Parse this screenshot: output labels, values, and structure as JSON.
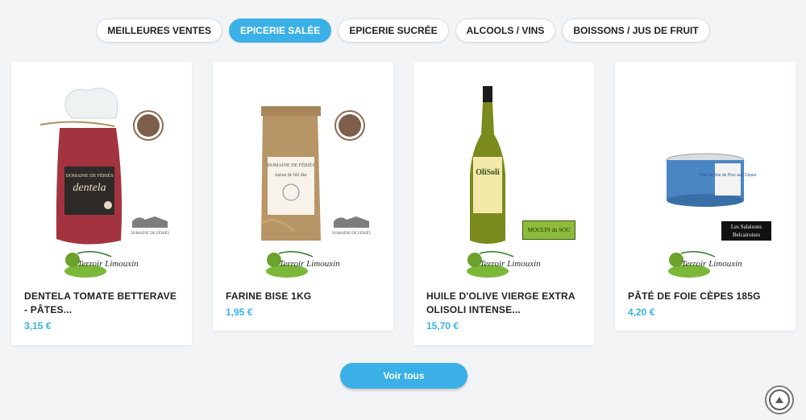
{
  "tabs": [
    {
      "label": "MEILLEURES VENTES",
      "active": false
    },
    {
      "label": "EPICERIE SALÉE",
      "active": true
    },
    {
      "label": "EPICERIE SUCRÉE",
      "active": false
    },
    {
      "label": "ALCOOLS / VINS",
      "active": false
    },
    {
      "label": "BOISSONS / JUS DE FRUIT",
      "active": false
    }
  ],
  "products": [
    {
      "name": "DENTELA TOMATE BETTERAVE - PÂTES...",
      "price": "3,15 €",
      "image": "pasta-bag",
      "brand": "DOMAINE DE FÉRIÈS",
      "label": "dentela"
    },
    {
      "name": "FARINE BISE 1KG",
      "price": "1,95 €",
      "image": "flour-bag",
      "brand": "DOMAINE DE FÉRIÈS",
      "label": "farine de blé dur"
    },
    {
      "name": "HUILE D'OLIVE VIERGE EXTRA OLISOLI INTENSE...",
      "price": "15,70 €",
      "image": "olive-oil-bottle",
      "brand": "MOULIN du SOU",
      "label": "OliSoli"
    },
    {
      "name": "PÂTÉ DE FOIE CÈPES 185G",
      "price": "4,20 €",
      "image": "pate-tin",
      "brand": "Les Salaisons Belcairoises",
      "label": "Pâté de foie de Porc aux Cèpes"
    }
  ],
  "terroir_logo": "Terroir Limouxin",
  "view_all_label": "Voir tous",
  "colors": {
    "accent": "#3bb0e6"
  }
}
